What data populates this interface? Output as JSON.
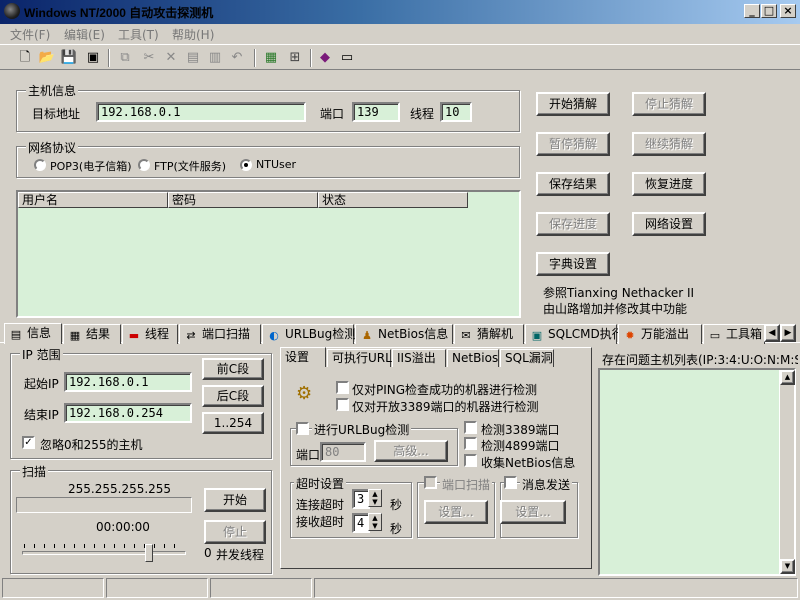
{
  "window": {
    "title": "Windows NT/2000 自动攻击探测机"
  },
  "menu": {
    "file": "文件(F)",
    "edit": "编辑(E)",
    "tools": "工具(T)",
    "help": "帮助(H)"
  },
  "toolbar": {
    "icons": [
      "new-file-icon",
      "open-folder-icon",
      "save-icon",
      "save-as-icon",
      "copy-icon",
      "cut-icon",
      "delete-icon",
      "paste-icon",
      "paste-special-icon",
      "undo-icon",
      "stats-icon",
      "network-icon",
      "book-icon",
      "id-card-icon"
    ]
  },
  "host_info": {
    "label": "主机信息",
    "target_label": "目标地址",
    "target_value": "192.168.0.1",
    "port_label": "端口",
    "port_value": "139",
    "threads_label": "线程",
    "threads_value": "10"
  },
  "protocol": {
    "label": "网络协议",
    "options": [
      "POP3(电子信箱)",
      "FTP(文件服务)",
      "NTUser"
    ],
    "selected": "NTUser"
  },
  "results_table": {
    "columns": [
      "用户名",
      "密码",
      "状态"
    ]
  },
  "actions": {
    "start": "开始猜解",
    "stop": "停止猜解",
    "pause": "暂停猜解",
    "resume": "继续猜解",
    "save_results": "保存结果",
    "restore_progress": "恢复进度",
    "save_progress": "保存进度",
    "network_settings": "网络设置",
    "dictionary": "字典设置"
  },
  "notes": {
    "line1": "参照Tianxing Nethacker II",
    "line2": "由山路增加并修改其中功能"
  },
  "tabs": [
    "信息",
    "结果",
    "线程",
    "端口扫描",
    "URLBug检测",
    "NetBios信息",
    "猜解机",
    "SQLCMD执行",
    "万能溢出",
    "工具箱"
  ],
  "active_tab": "信息",
  "ip_range": {
    "label": "IP 范围",
    "start_label": "起始IP",
    "start_value": "192.168.0.1",
    "end_label": "结束IP",
    "end_value": "192.168.0.254",
    "btn_prev": "前C段",
    "btn_next": "后C段",
    "btn_range": "1..254",
    "skip_label": "忽略0和255的主机"
  },
  "scan": {
    "label": "扫描",
    "current_ip": "255.255.255.255",
    "progress": 0,
    "time": "00:00:00",
    "start": "开始",
    "stop": "停止",
    "threads_count": "0",
    "threads_label": "并发线程",
    "slider_value": 0.8
  },
  "settings_tabs": [
    "设置",
    "可执行URL",
    "IIS溢出",
    "NetBios",
    "SQL漏洞"
  ],
  "settings": {
    "ping_check": "仅对PING检查成功的机器进行检测",
    "rdp_check": "仅对开放3389端口的机器进行检测",
    "urlbug_label": "进行URLBug检测",
    "port_label": "端口",
    "port_value": "80",
    "advanced": "高级...",
    "detect3389": "检测3389端口",
    "detect4899": "检测4899端口",
    "collect_netbios": "收集NetBios信息",
    "timeout_label": "超时设置",
    "connect_timeout": "连接超时",
    "connect_value": "3",
    "recv_timeout": "接收超时",
    "recv_value": "4",
    "seconds": "秒",
    "port_scan": "端口扫描",
    "message_send": "消息发送",
    "set_btn": "设置..."
  },
  "problem_hosts": {
    "label": "存在问题主机列表(IP:3:4:U:O:N:M:S"
  },
  "colors": {
    "face": "#d4d0c8",
    "list_bg": "#d8f0d8",
    "title_start": "#0a246a",
    "title_end": "#a6caf0"
  }
}
